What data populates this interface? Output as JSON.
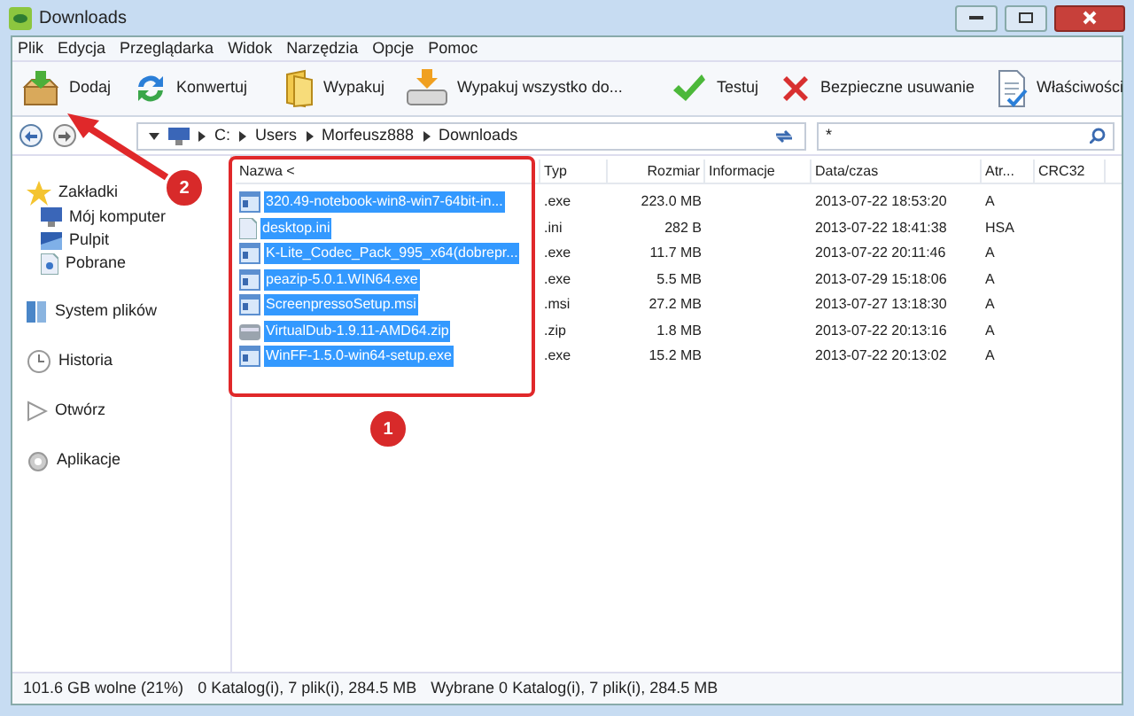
{
  "window": {
    "title": "Downloads"
  },
  "menu": [
    "Plik",
    "Edycja",
    "Przeglądarka",
    "Widok",
    "Narzędzia",
    "Opcje",
    "Pomoc"
  ],
  "toolbar": [
    {
      "label": "Dodaj",
      "kind": "add"
    },
    {
      "label": "Konwertuj",
      "kind": "convert"
    },
    {
      "label": "Wypakuj",
      "kind": "extract"
    },
    {
      "label": "Wypakuj wszystko do...",
      "kind": "extract_all"
    },
    {
      "label": "Testuj",
      "kind": "test"
    },
    {
      "label": "Bezpieczne usuwanie",
      "kind": "delete"
    },
    {
      "label": "Właściwości",
      "kind": "properties"
    }
  ],
  "address": {
    "path": [
      "C:",
      "Users",
      "Morfeusz888",
      "Downloads"
    ],
    "filter": "*"
  },
  "sidebar": {
    "sections": [
      {
        "label": "Zakładki",
        "kind": "star",
        "children": [
          {
            "label": "Mój komputer",
            "kind": "computer"
          },
          {
            "label": "Pulpit",
            "kind": "desktop"
          },
          {
            "label": "Pobrane",
            "kind": "downloads"
          }
        ]
      },
      {
        "label": "System plików",
        "kind": "fs"
      },
      {
        "label": "Historia",
        "kind": "history"
      },
      {
        "label": "Otwórz",
        "kind": "open"
      },
      {
        "label": "Aplikacje",
        "kind": "apps"
      }
    ]
  },
  "table": {
    "columns": [
      "Nazwa <",
      "Typ",
      "Rozmiar",
      "Informacje",
      "Data/czas",
      "Atr...",
      "CRC32"
    ],
    "rows": [
      {
        "name": "320.49-notebook-win8-win7-64bit-in...",
        "type": ".exe",
        "size": "223.0 MB",
        "date": "2013-07-22 18:53:20",
        "attr": "A",
        "selected": true,
        "kind": "exe"
      },
      {
        "name": "desktop.ini",
        "type": ".ini",
        "size": "282 B",
        "date": "2013-07-22 18:41:38",
        "attr": "HSA",
        "selected": true,
        "kind": "doc"
      },
      {
        "name": "K-Lite_Codec_Pack_995_x64(dobrepr...",
        "type": ".exe",
        "size": "11.7 MB",
        "date": "2013-07-22 20:11:46",
        "attr": "A",
        "selected": true,
        "kind": "exe"
      },
      {
        "name": "peazip-5.0.1.WIN64.exe",
        "type": ".exe",
        "size": "5.5 MB",
        "date": "2013-07-29 15:18:06",
        "attr": "A",
        "selected": true,
        "kind": "exe"
      },
      {
        "name": "ScreenpressoSetup.msi",
        "type": ".msi",
        "size": "27.2 MB",
        "date": "2013-07-27 13:18:30",
        "attr": "A",
        "selected": true,
        "kind": "exe"
      },
      {
        "name": "VirtualDub-1.9.11-AMD64.zip",
        "type": ".zip",
        "size": "1.8 MB",
        "date": "2013-07-22 20:13:16",
        "attr": "A",
        "selected": true,
        "kind": "zip"
      },
      {
        "name": "WinFF-1.5.0-win64-setup.exe",
        "type": ".exe",
        "size": "15.2 MB",
        "date": "2013-07-22 20:13:02",
        "attr": "A",
        "selected": true,
        "kind": "exe"
      }
    ]
  },
  "status_bar": [
    "101.6 GB wolne (21%)",
    "0 Katalog(i), 7 plik(i), 284.5 MB",
    "Wybrane 0 Katalog(i), 7 plik(i), 284.5 MB"
  ],
  "annotations": [
    "1",
    "2"
  ]
}
